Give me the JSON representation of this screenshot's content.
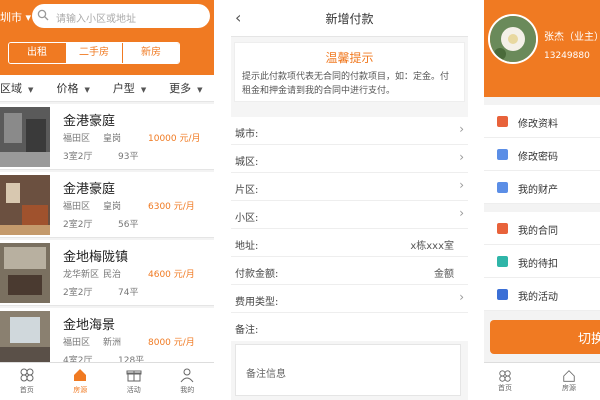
{
  "panel1": {
    "city": "圳市 ▾",
    "search_placeholder": "请输入小区或地址",
    "segments": [
      "出租",
      "二手房",
      "新房"
    ],
    "filters": [
      "区域",
      "价格",
      "户型",
      "更多"
    ],
    "listings": [
      {
        "name": "金港豪庭",
        "district": "福田区",
        "area": "皇岗",
        "price": "10000 元/月",
        "rooms": "3室2厅",
        "size": "93平"
      },
      {
        "name": "金港豪庭",
        "district": "福田区",
        "area": "皇岗",
        "price": "6300 元/月",
        "rooms": "2室2厅",
        "size": "56平"
      },
      {
        "name": "金地梅陇镇",
        "district": "龙华新区",
        "area": "民治",
        "price": "4600 元/月",
        "rooms": "2室2厅",
        "size": "74平"
      },
      {
        "name": "金地海景",
        "district": "福田区",
        "area": "新洲",
        "price": "8000 元/月",
        "rooms": "4室2厅",
        "size": "128平"
      }
    ],
    "tabs": [
      "首页",
      "房源",
      "活动",
      "我的"
    ]
  },
  "panel2": {
    "title": "新增付款",
    "notice_title": "温馨提示",
    "notice_body": "提示此付款项代表无合同的付款项目，如：定金。付租金和押金请到我的合同中进行支付。",
    "rows": [
      {
        "label": "城市:",
        "value": ""
      },
      {
        "label": "城区:",
        "value": ""
      },
      {
        "label": "片区:",
        "value": ""
      },
      {
        "label": "小区:",
        "value": ""
      },
      {
        "label": "地址:",
        "value": "x栋xxx室"
      },
      {
        "label": "付款金额:",
        "value": "金额"
      },
      {
        "label": "费用类型:",
        "value": ""
      },
      {
        "label": "备注:",
        "value": ""
      }
    ],
    "notes_placeholder": "备注信息"
  },
  "panel3": {
    "name": "张杰（业主）",
    "phone": "13249880",
    "menu": [
      "修改资料",
      "修改密码",
      "我的财产",
      "我的合同",
      "我的待扣",
      "我的活动"
    ],
    "menu_colors": [
      "#e8623a",
      "#5b8ee6",
      "#5b8ee6",
      "#e8623a",
      "#2fb5a8",
      "#3b6fd6"
    ],
    "logout": "切换",
    "tabs": [
      "首页",
      "房源"
    ]
  },
  "colors": {
    "accent": "#f07a22"
  }
}
